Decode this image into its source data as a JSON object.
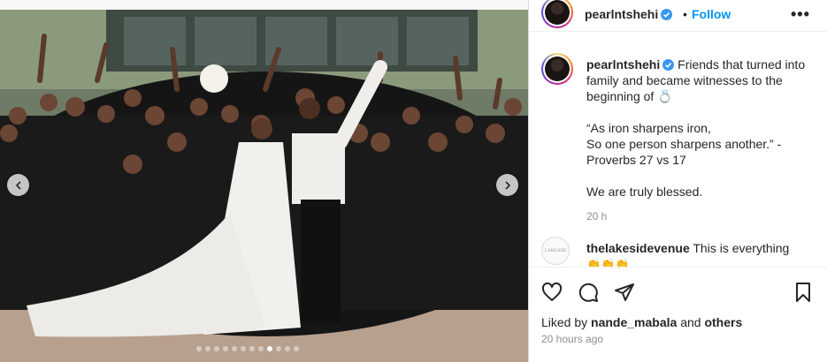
{
  "post": {
    "author": "pearlntshehi",
    "follow_label": "Follow",
    "separator": "•",
    "more_label": "•••",
    "caption": {
      "username": "pearlntshehi",
      "line1": "Friends that turned into family and became witnesses to the beginning of ",
      "line1_emoji": "💍",
      "line2": "“As iron sharpens iron,\nSo one person sharpens another.” - Proverbs 27 vs 17",
      "line3": "We are truly blessed.",
      "time": "20 h"
    },
    "comments": [
      {
        "username": "thelakesidevenue",
        "text": "This is everything",
        "emoji": "👏👏👏",
        "avatar_text": "LAKESIDE"
      }
    ],
    "liked_by_prefix": "Liked by ",
    "liked_by_user": "nande_mabala",
    "liked_by_and": " and ",
    "liked_by_others": "others",
    "timestamp": "20 hours ago"
  },
  "media": {
    "carousel_dots": 12,
    "active_dot": 8
  },
  "icons": {
    "verified": "verified-badge-icon",
    "like": "heart-icon",
    "comment": "comment-bubble-icon",
    "share": "paper-plane-icon",
    "save": "bookmark-icon",
    "prev": "chevron-left-icon",
    "next": "chevron-right-icon"
  },
  "colors": {
    "link_blue": "#0095f6",
    "verified_blue": "#3897f0",
    "muted": "#8e8e8e",
    "text": "#262626"
  }
}
